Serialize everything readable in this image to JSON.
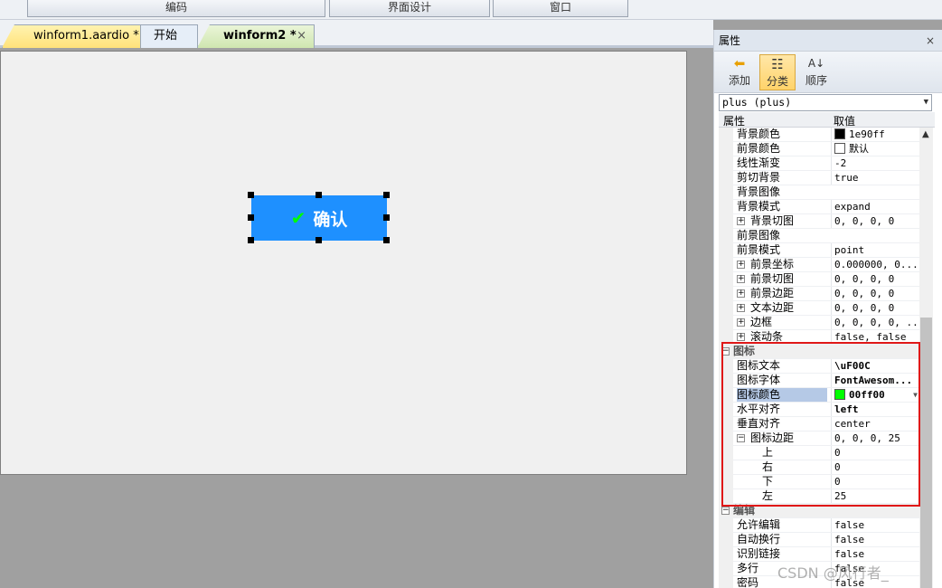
{
  "topbar": {
    "btn_code": "编码",
    "btn_design": "界面设计",
    "btn_window": "窗口"
  },
  "tabs": [
    {
      "label": "winform1.aardio *"
    },
    {
      "label": "开始页..."
    },
    {
      "label": "winform2 *"
    }
  ],
  "tab_close": "×",
  "canvas": {
    "button_text": "确认",
    "button_icon": "check-icon",
    "button_bg": "#1e90ff",
    "icon_color": "#00ff00"
  },
  "panel": {
    "title": "属性",
    "close": "×",
    "tools": [
      {
        "label": "添加"
      },
      {
        "label": "分类"
      },
      {
        "label": "顺序"
      }
    ],
    "selector_value": "plus (plus)",
    "col_name": "属性",
    "col_value": "取值",
    "rows": [
      {
        "name": "背景颜色",
        "value": "1e90ff",
        "swatch": "#000000"
      },
      {
        "name": "前景颜色",
        "value": "默认",
        "swatch": "#ffffff"
      },
      {
        "name": "线性渐变",
        "value": "-2"
      },
      {
        "name": "剪切背景",
        "value": "true"
      },
      {
        "name": "背景图像",
        "value": ""
      },
      {
        "name": "背景模式",
        "value": "expand"
      },
      {
        "name": "背景切图",
        "value": "0, 0, 0, 0"
      },
      {
        "name": "前景图像",
        "value": ""
      },
      {
        "name": "前景模式",
        "value": "point"
      },
      {
        "name": "前景坐标",
        "value": "0.000000, 0...."
      },
      {
        "name": "前景切图",
        "value": "0, 0, 0, 0"
      },
      {
        "name": "前景边距",
        "value": "0, 0, 0, 0"
      },
      {
        "name": "文本边距",
        "value": "0, 0, 0, 0"
      },
      {
        "name": "边框",
        "value": "0, 0, 0, 0, ..."
      },
      {
        "name": "滚动条",
        "value": "false, false"
      },
      {
        "name": "图标",
        "value": ""
      },
      {
        "name": "图标文本",
        "value": "\\uF00C"
      },
      {
        "name": "图标字体",
        "value": "FontAwesom..."
      },
      {
        "name": "图标颜色",
        "value": "00ff00",
        "swatch": "#00ff00"
      },
      {
        "name": "水平对齐",
        "value": "left"
      },
      {
        "name": "垂直对齐",
        "value": "center"
      },
      {
        "name": "图标边距",
        "value": "0, 0, 0, 25"
      },
      {
        "name": "上",
        "value": "0"
      },
      {
        "name": "右",
        "value": "0"
      },
      {
        "name": "下",
        "value": "0"
      },
      {
        "name": "左",
        "value": "25"
      },
      {
        "name": "编辑",
        "value": ""
      },
      {
        "name": "允许编辑",
        "value": "false"
      },
      {
        "name": "自动换行",
        "value": "false"
      },
      {
        "name": "识别链接",
        "value": "false"
      },
      {
        "name": "多行",
        "value": "false"
      },
      {
        "name": "密码",
        "value": "false"
      }
    ]
  },
  "watermark": "CSDN @风行者_"
}
